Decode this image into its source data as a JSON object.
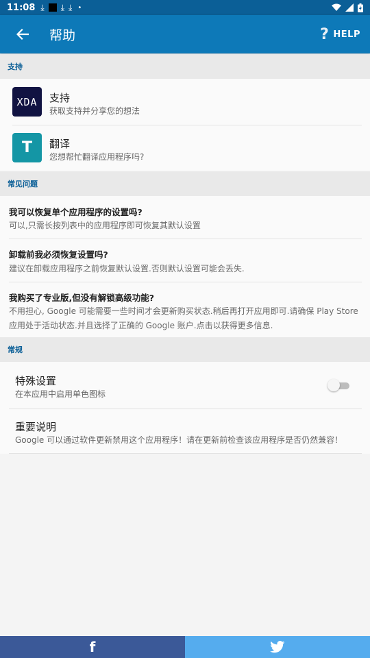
{
  "status_bar": {
    "time": "11:08",
    "dl_glyph": "⤓"
  },
  "app_bar": {
    "title": "帮助",
    "help_label": "HELP",
    "help_glyph": "?"
  },
  "sections": {
    "support": "支持",
    "faq": "常见问题",
    "general": "常规"
  },
  "support_items": [
    {
      "icon_text": "XDA",
      "title": "支持",
      "subtitle": "获取支持并分享您的想法"
    },
    {
      "icon_text": "T",
      "title": "翻译",
      "subtitle": "您想帮忙翻译应用程序吗?"
    }
  ],
  "faq_items": [
    {
      "q": "我可以恢复单个应用程序的设置吗?",
      "a": "可以,只需长按列表中的应用程序即可恢复其默认设置"
    },
    {
      "q": "卸载前我必须恢复设置吗?",
      "a": "建议在卸载应用程序之前恢复默认设置.否则默认设置可能会丢失."
    },
    {
      "q": "我购买了专业版,但没有解锁高级功能?",
      "a": "不用担心, Google 可能需要一些时间才会更新购买状态.稍后再打开应用即可.请确保 Play Store 应用处于活动状态.并且选择了正确的 Google 账户.点击以获得更多信息."
    }
  ],
  "general_items": [
    {
      "title": "特殊设置",
      "subtitle": "在本应用中启用单色图标",
      "toggle_on": false
    },
    {
      "title": "重要说明",
      "subtitle": "Google 可以通过软件更新禁用这个应用程序！请在更新前检查该应用程序是否仍然兼容！"
    }
  ],
  "social": {
    "facebook_glyph": "f"
  },
  "colors": {
    "status_bar": "#0b5f97",
    "app_bar": "#0d79b8",
    "section_text": "#0b5f97",
    "facebook": "#3b5998",
    "twitter": "#55acee"
  }
}
